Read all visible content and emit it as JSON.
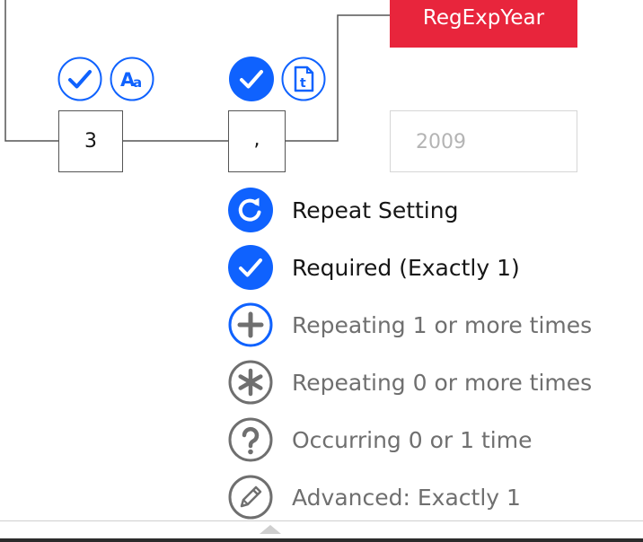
{
  "diagram": {
    "output_tag": "RegExpYear",
    "node_digits": "3",
    "node_separator": ",",
    "sample_value": "2009"
  },
  "badges": [
    {
      "name": "check-icon",
      "state": "outline"
    },
    {
      "name": "text-case-icon",
      "glyph": "Aa",
      "state": "outline"
    },
    {
      "name": "check-icon",
      "state": "filled"
    },
    {
      "name": "text-file-icon",
      "glyph": "t",
      "state": "outline"
    }
  ],
  "menu": {
    "items": [
      {
        "label": "Repeat Setting",
        "icon": "repeat-icon",
        "emphasis": true
      },
      {
        "label": "Required (Exactly 1)",
        "icon": "check-icon",
        "emphasis": true
      },
      {
        "label": "Repeating 1 or more times",
        "icon": "plus-icon",
        "emphasis": false
      },
      {
        "label": "Repeating 0 or more times",
        "icon": "asterisk-icon",
        "emphasis": false
      },
      {
        "label": "Occurring 0 or 1 time",
        "icon": "question-icon",
        "emphasis": false
      },
      {
        "label": "Advanced: Exactly 1",
        "icon": "pencil-icon",
        "emphasis": false
      }
    ]
  },
  "colors": {
    "accent_blue": "#0f62fe",
    "tag_red": "#e8253c",
    "icon_gray": "#6f6f6f",
    "wire": "#555555"
  }
}
